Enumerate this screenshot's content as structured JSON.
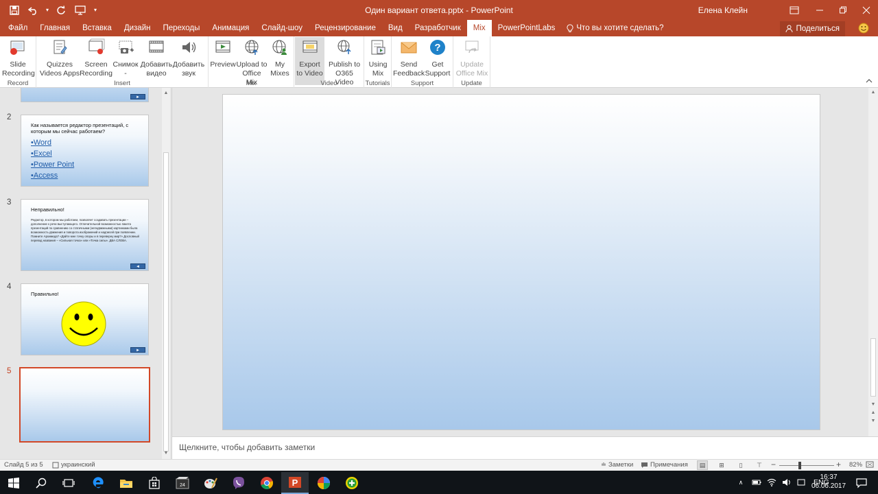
{
  "app": {
    "title": "Один вариант ответа.pptx - PowerPoint",
    "user": "Елена Клейн"
  },
  "tabs": [
    "Файл",
    "Главная",
    "Вставка",
    "Дизайн",
    "Переходы",
    "Анимация",
    "Слайд-шоу",
    "Рецензирование",
    "Вид",
    "Разработчик",
    "Mix",
    "PowerPointLabs"
  ],
  "active_tab": "Mix",
  "tell_me": "Что вы хотите сделать?",
  "share_label": "Поделиться",
  "ribbon": {
    "groups": {
      "record": "Record",
      "insert": "Insert",
      "mix": "Mix",
      "video": "Video",
      "tutorials": "Tutorials",
      "support": "Support",
      "update": "Update"
    },
    "buttons": {
      "slide_recording": [
        "Slide",
        "Recording"
      ],
      "quizzes": [
        "Quizzes",
        "Videos Apps"
      ],
      "screen_recording": [
        "Screen",
        "Recording"
      ],
      "snapshot": [
        "Снимок",
        "-"
      ],
      "add_video": [
        "Добавить",
        "видео"
      ],
      "add_audio": [
        "Добавить",
        "звук"
      ],
      "preview": [
        "Preview",
        ""
      ],
      "upload": [
        "Upload to",
        "Office Mix"
      ],
      "my_mixes": [
        "My",
        "Mixes"
      ],
      "export": [
        "Export",
        "to Video"
      ],
      "publish": [
        "Publish to",
        "O365 Video"
      ],
      "using_mix": [
        "Using",
        "Mix"
      ],
      "send_feedback": [
        "Send",
        "Feedback"
      ],
      "get_support": [
        "Get",
        "Support"
      ],
      "update_mix": [
        "Update",
        "Office Mix"
      ]
    }
  },
  "slides": {
    "s2": {
      "num": "2",
      "question": "Как называется редактор презентаций, с которым мы сейчас работаем?",
      "options": [
        "•Word",
        "•Excel",
        "•Power Point",
        "•Access"
      ]
    },
    "s3": {
      "num": "3",
      "title": "Неправильно!",
      "body": "Редактор, в котором мы работаем, позволяет создавать презентации – дополнение к речи выступающего. Отличительной возможностью пакета презентаций по сравнению со статичными (неподвижными) картинками была возможность движения и поворота изображений и надписей при появлении. Помните Архимеда? «Дайте мне точку опоры и я переверну мир?» Дословный перевод названия – «Сильная точка» или «Точка силы». ДВА СЛОВА."
    },
    "s4": {
      "num": "4",
      "title": "Правильно!"
    },
    "s5": {
      "num": "5"
    }
  },
  "notes_placeholder": "Щелкните, чтобы добавить заметки",
  "status": {
    "slide_info": "Слайд 5 из 5",
    "language": "украинский",
    "notes": "Заметки",
    "comments": "Примечания",
    "zoom": "82%"
  },
  "taskbar": {
    "lang": "ENG",
    "time": "16:37",
    "date": "06.06.2017"
  },
  "colors": {
    "accent": "#b7472a",
    "selected_border": "#d24726"
  }
}
